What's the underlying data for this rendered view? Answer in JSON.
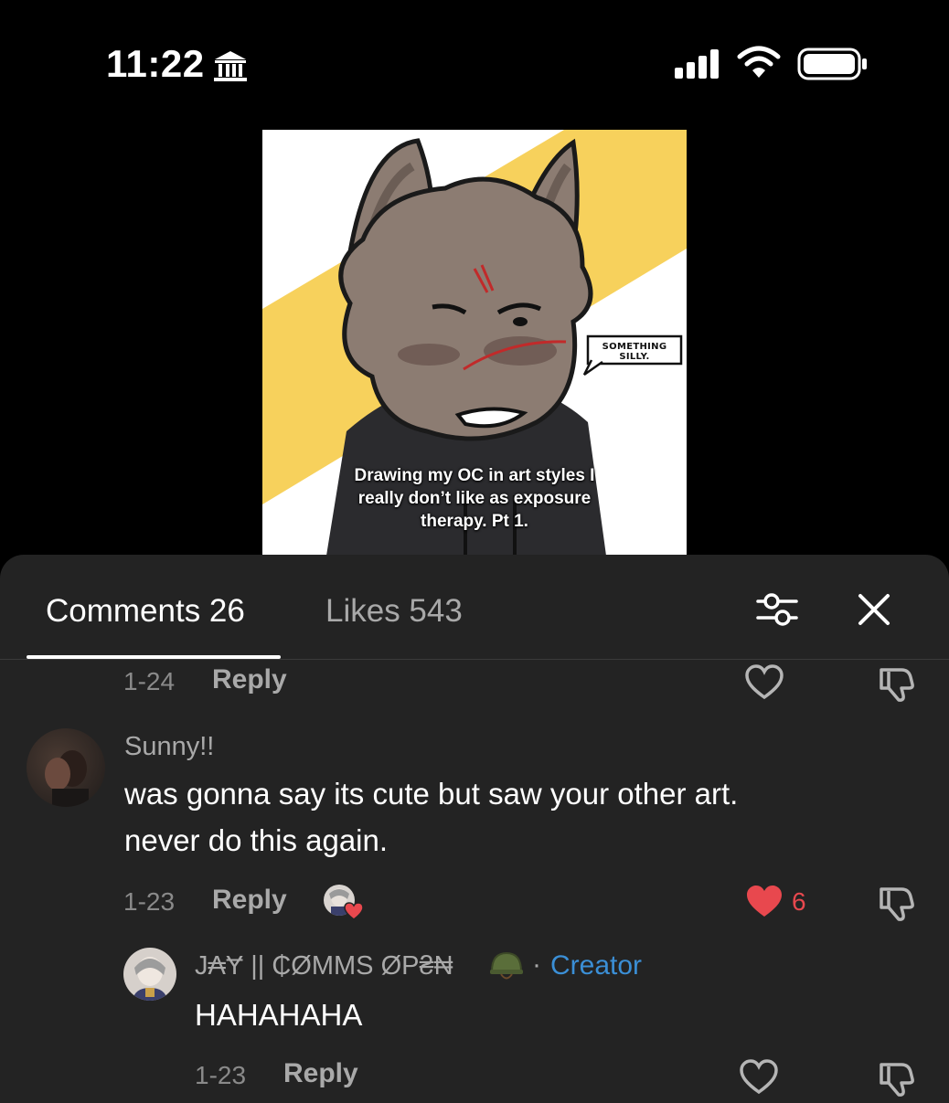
{
  "status_bar": {
    "time": "11:22",
    "icons": [
      "bank-icon",
      "cellular-signal-icon",
      "wifi-icon",
      "battery-icon"
    ]
  },
  "video": {
    "caption": "Drawing my OC in art styles I\nreally don’t like as exposure\ntherapy. Pt 1.",
    "speech_bubble": "SOMETHING SILLY."
  },
  "tabs": {
    "comments": "Comments 26",
    "likes": "Likes 543"
  },
  "comments": [
    {
      "date": "1-24",
      "reply_label": "Reply"
    },
    {
      "username": "Sunny!!",
      "text": "was gonna say its cute but saw your other art.\nnever do this again.",
      "date": "1-23",
      "reply_label": "Reply",
      "likes": "6",
      "liked": true,
      "liked_by_creator": true
    }
  ],
  "reply": {
    "username": "J₳Ɏ || ₵ØMMS ØP₴₦",
    "separator": "·",
    "creator_label": "Creator",
    "text": "HAHAHAHA",
    "date": "1-23",
    "reply_label": "Reply"
  },
  "colors": {
    "sheet_bg": "#232323",
    "accent_like": "#e8484e",
    "creator_blue": "#3b8fd6",
    "video_yellow": "#f7d15c"
  }
}
